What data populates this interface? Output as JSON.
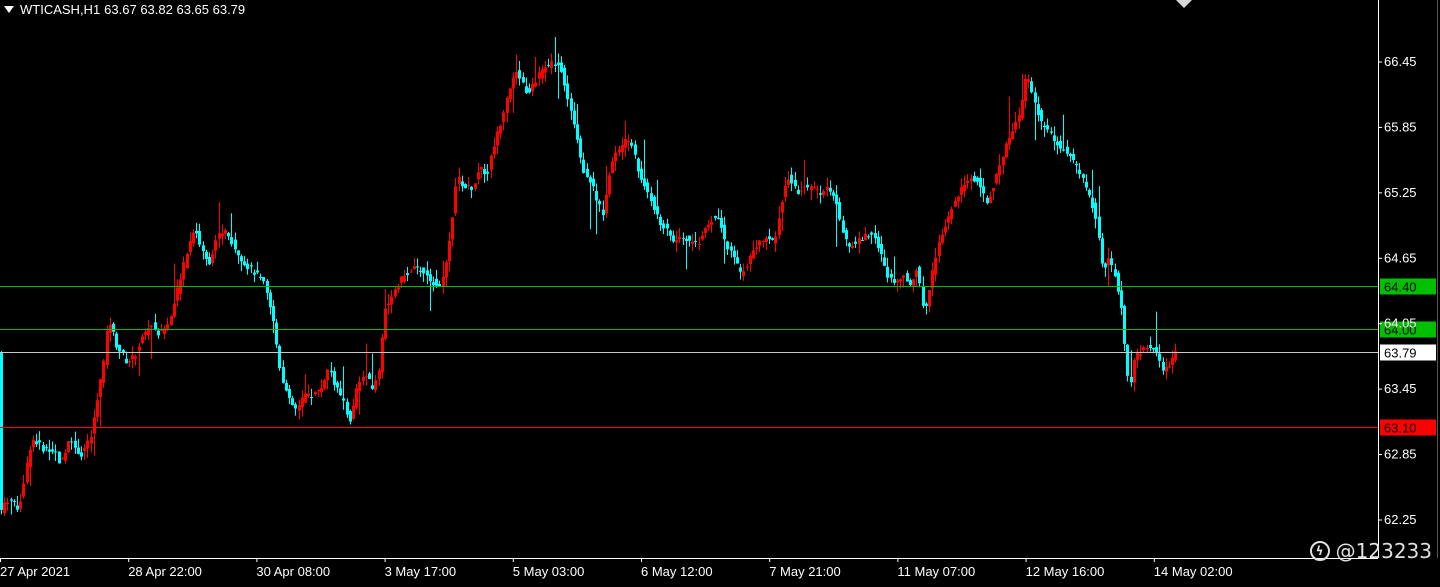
{
  "header": {
    "symbol": "WTICASH,H1",
    "ohlc": "63.67 63.82 63.65 63.79"
  },
  "watermark": {
    "text": "@123233"
  },
  "colors": {
    "background": "#000000",
    "bull": "#ff0000",
    "bear": "#00ffff",
    "axis": "#ffffff",
    "support_line": "#00c000",
    "current_line": "#c8c8c8",
    "red_line": "#ff0000"
  },
  "chart_data": {
    "type": "candlestick",
    "symbol": "WTICASH",
    "timeframe": "H1",
    "ylim": [
      62.0,
      66.9
    ],
    "y_ticks": [
      62.25,
      62.85,
      63.45,
      64.05,
      64.65,
      65.25,
      65.85,
      66.45
    ],
    "x_ticks": [
      "27 Apr 2021",
      "28 Apr 22:00",
      "30 Apr 08:00",
      "3 May 17:00",
      "5 May 03:00",
      "6 May 12:00",
      "7 May 21:00",
      "11 May 07:00",
      "12 May 16:00",
      "14 May 02:00"
    ],
    "levels": [
      {
        "price": "64.40",
        "value": 64.4,
        "color": "#00c000",
        "label_bg": "#00c000",
        "label_fg": "#000000"
      },
      {
        "price": "64.00",
        "value": 64.0,
        "color": "#00c000",
        "label_bg": "#00c000",
        "label_fg": "#000000"
      },
      {
        "price": "63.79",
        "value": 63.79,
        "color": "#c8c8c8",
        "label_bg": "#ffffff",
        "label_fg": "#000000"
      },
      {
        "price": "63.10",
        "value": 63.1,
        "color": "#ff0000",
        "label_bg": "#ff0000",
        "label_fg": "#000000"
      }
    ],
    "price_path": [
      [
        0,
        62.3
      ],
      [
        10,
        62.45
      ],
      [
        20,
        62.35
      ],
      [
        33,
        63.0
      ],
      [
        45,
        62.9
      ],
      [
        55,
        62.9
      ],
      [
        62,
        62.75
      ],
      [
        70,
        63.0
      ],
      [
        82,
        62.85
      ],
      [
        92,
        63.0
      ],
      [
        105,
        63.7
      ],
      [
        110,
        64.1
      ],
      [
        118,
        63.85
      ],
      [
        128,
        63.7
      ],
      [
        136,
        63.75
      ],
      [
        142,
        63.9
      ],
      [
        152,
        64.05
      ],
      [
        160,
        63.95
      ],
      [
        170,
        64.05
      ],
      [
        180,
        64.4
      ],
      [
        188,
        64.7
      ],
      [
        196,
        64.95
      ],
      [
        202,
        64.75
      ],
      [
        210,
        64.6
      ],
      [
        218,
        64.85
      ],
      [
        226,
        64.9
      ],
      [
        236,
        64.75
      ],
      [
        246,
        64.6
      ],
      [
        258,
        64.5
      ],
      [
        266,
        64.4
      ],
      [
        274,
        64.1
      ],
      [
        282,
        63.6
      ],
      [
        290,
        63.35
      ],
      [
        298,
        63.25
      ],
      [
        306,
        63.4
      ],
      [
        314,
        63.4
      ],
      [
        322,
        63.45
      ],
      [
        330,
        63.65
      ],
      [
        338,
        63.45
      ],
      [
        346,
        63.3
      ],
      [
        352,
        63.15
      ],
      [
        358,
        63.45
      ],
      [
        366,
        63.6
      ],
      [
        374,
        63.45
      ],
      [
        380,
        63.6
      ],
      [
        386,
        64.2
      ],
      [
        394,
        64.3
      ],
      [
        402,
        64.45
      ],
      [
        412,
        64.55
      ],
      [
        422,
        64.55
      ],
      [
        432,
        64.45
      ],
      [
        440,
        64.4
      ],
      [
        446,
        64.5
      ],
      [
        452,
        64.9
      ],
      [
        458,
        65.4
      ],
      [
        466,
        65.3
      ],
      [
        474,
        65.3
      ],
      [
        482,
        65.5
      ],
      [
        488,
        65.4
      ],
      [
        494,
        65.65
      ],
      [
        502,
        65.9
      ],
      [
        510,
        66.2
      ],
      [
        518,
        66.35
      ],
      [
        524,
        66.25
      ],
      [
        530,
        66.15
      ],
      [
        538,
        66.3
      ],
      [
        546,
        66.4
      ],
      [
        554,
        66.45
      ],
      [
        562,
        66.4
      ],
      [
        570,
        66.1
      ],
      [
        578,
        65.8
      ],
      [
        584,
        65.45
      ],
      [
        590,
        65.4
      ],
      [
        598,
        65.2
      ],
      [
        604,
        65.05
      ],
      [
        610,
        65.4
      ],
      [
        616,
        65.6
      ],
      [
        624,
        65.7
      ],
      [
        632,
        65.75
      ],
      [
        638,
        65.5
      ],
      [
        644,
        65.35
      ],
      [
        652,
        65.2
      ],
      [
        660,
        65.0
      ],
      [
        668,
        64.9
      ],
      [
        676,
        64.8
      ],
      [
        684,
        64.85
      ],
      [
        692,
        64.8
      ],
      [
        700,
        64.8
      ],
      [
        708,
        64.95
      ],
      [
        716,
        65.05
      ],
      [
        722,
        64.95
      ],
      [
        728,
        64.75
      ],
      [
        736,
        64.65
      ],
      [
        742,
        64.5
      ],
      [
        748,
        64.6
      ],
      [
        754,
        64.7
      ],
      [
        760,
        64.8
      ],
      [
        768,
        64.85
      ],
      [
        776,
        64.8
      ],
      [
        782,
        65.15
      ],
      [
        790,
        65.4
      ],
      [
        798,
        65.25
      ],
      [
        806,
        65.3
      ],
      [
        814,
        65.3
      ],
      [
        822,
        65.25
      ],
      [
        830,
        65.3
      ],
      [
        838,
        65.15
      ],
      [
        844,
        64.9
      ],
      [
        850,
        64.75
      ],
      [
        858,
        64.8
      ],
      [
        866,
        64.85
      ],
      [
        874,
        64.9
      ],
      [
        880,
        64.75
      ],
      [
        888,
        64.5
      ],
      [
        896,
        64.45
      ],
      [
        904,
        64.5
      ],
      [
        912,
        64.4
      ],
      [
        918,
        64.55
      ],
      [
        926,
        64.15
      ],
      [
        932,
        64.45
      ],
      [
        940,
        64.8
      ],
      [
        948,
        65.0
      ],
      [
        956,
        65.15
      ],
      [
        964,
        65.3
      ],
      [
        972,
        65.4
      ],
      [
        980,
        65.35
      ],
      [
        988,
        65.15
      ],
      [
        996,
        65.35
      ],
      [
        1004,
        65.6
      ],
      [
        1012,
        65.8
      ],
      [
        1020,
        65.95
      ],
      [
        1028,
        66.35
      ],
      [
        1034,
        66.15
      ],
      [
        1042,
        65.9
      ],
      [
        1050,
        65.8
      ],
      [
        1058,
        65.7
      ],
      [
        1066,
        65.65
      ],
      [
        1074,
        65.55
      ],
      [
        1082,
        65.4
      ],
      [
        1090,
        65.25
      ],
      [
        1098,
        65.0
      ],
      [
        1104,
        64.55
      ],
      [
        1110,
        64.65
      ],
      [
        1116,
        64.5
      ],
      [
        1122,
        64.25
      ],
      [
        1128,
        63.6
      ],
      [
        1132,
        63.5
      ],
      [
        1136,
        63.75
      ],
      [
        1144,
        63.8
      ],
      [
        1152,
        63.85
      ],
      [
        1158,
        63.8
      ],
      [
        1164,
        63.6
      ],
      [
        1170,
        63.65
      ],
      [
        1176,
        63.79
      ]
    ]
  }
}
